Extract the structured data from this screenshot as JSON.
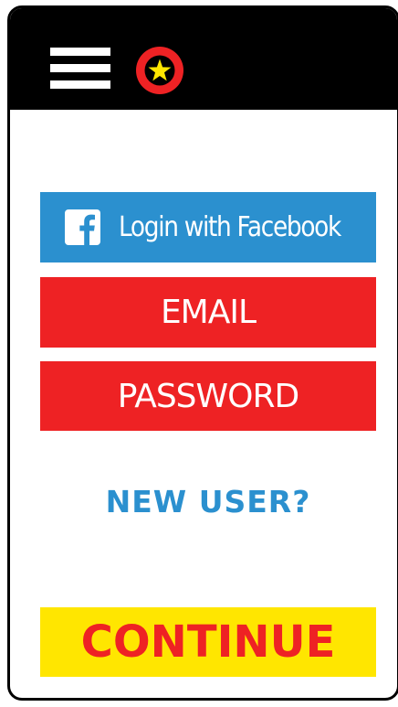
{
  "header": {
    "menu_icon": "hamburger-menu-icon",
    "logo_icon": "star-badge-logo-icon"
  },
  "login": {
    "facebook_label": "Login with Facebook",
    "facebook_icon": "facebook-icon",
    "email_label": "EMAIL",
    "password_label": "PASSWORD",
    "new_user_label": "NEW USER?",
    "continue_label": "CONTINUE"
  },
  "colors": {
    "topbar": "#000000",
    "facebook_blue": "#2b90cf",
    "red": "#ee2224",
    "yellow": "#ffe600",
    "star_yellow": "#ffe600",
    "white": "#ffffff"
  }
}
